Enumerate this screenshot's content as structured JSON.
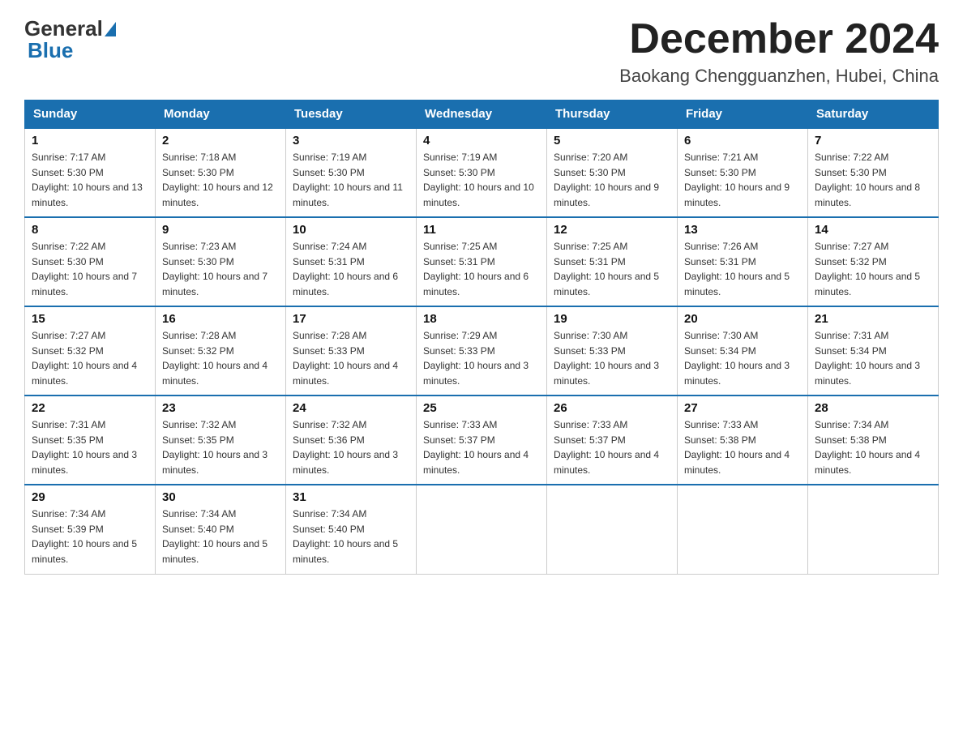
{
  "header": {
    "logo": {
      "text1": "General",
      "text2": "Blue"
    },
    "title": "December 2024",
    "location": "Baokang Chengguanzhen, Hubei, China"
  },
  "weekdays": [
    "Sunday",
    "Monday",
    "Tuesday",
    "Wednesday",
    "Thursday",
    "Friday",
    "Saturday"
  ],
  "weeks": [
    [
      {
        "day": "1",
        "sunrise": "7:17 AM",
        "sunset": "5:30 PM",
        "daylight": "10 hours and 13 minutes."
      },
      {
        "day": "2",
        "sunrise": "7:18 AM",
        "sunset": "5:30 PM",
        "daylight": "10 hours and 12 minutes."
      },
      {
        "day": "3",
        "sunrise": "7:19 AM",
        "sunset": "5:30 PM",
        "daylight": "10 hours and 11 minutes."
      },
      {
        "day": "4",
        "sunrise": "7:19 AM",
        "sunset": "5:30 PM",
        "daylight": "10 hours and 10 minutes."
      },
      {
        "day": "5",
        "sunrise": "7:20 AM",
        "sunset": "5:30 PM",
        "daylight": "10 hours and 9 minutes."
      },
      {
        "day": "6",
        "sunrise": "7:21 AM",
        "sunset": "5:30 PM",
        "daylight": "10 hours and 9 minutes."
      },
      {
        "day": "7",
        "sunrise": "7:22 AM",
        "sunset": "5:30 PM",
        "daylight": "10 hours and 8 minutes."
      }
    ],
    [
      {
        "day": "8",
        "sunrise": "7:22 AM",
        "sunset": "5:30 PM",
        "daylight": "10 hours and 7 minutes."
      },
      {
        "day": "9",
        "sunrise": "7:23 AM",
        "sunset": "5:30 PM",
        "daylight": "10 hours and 7 minutes."
      },
      {
        "day": "10",
        "sunrise": "7:24 AM",
        "sunset": "5:31 PM",
        "daylight": "10 hours and 6 minutes."
      },
      {
        "day": "11",
        "sunrise": "7:25 AM",
        "sunset": "5:31 PM",
        "daylight": "10 hours and 6 minutes."
      },
      {
        "day": "12",
        "sunrise": "7:25 AM",
        "sunset": "5:31 PM",
        "daylight": "10 hours and 5 minutes."
      },
      {
        "day": "13",
        "sunrise": "7:26 AM",
        "sunset": "5:31 PM",
        "daylight": "10 hours and 5 minutes."
      },
      {
        "day": "14",
        "sunrise": "7:27 AM",
        "sunset": "5:32 PM",
        "daylight": "10 hours and 5 minutes."
      }
    ],
    [
      {
        "day": "15",
        "sunrise": "7:27 AM",
        "sunset": "5:32 PM",
        "daylight": "10 hours and 4 minutes."
      },
      {
        "day": "16",
        "sunrise": "7:28 AM",
        "sunset": "5:32 PM",
        "daylight": "10 hours and 4 minutes."
      },
      {
        "day": "17",
        "sunrise": "7:28 AM",
        "sunset": "5:33 PM",
        "daylight": "10 hours and 4 minutes."
      },
      {
        "day": "18",
        "sunrise": "7:29 AM",
        "sunset": "5:33 PM",
        "daylight": "10 hours and 3 minutes."
      },
      {
        "day": "19",
        "sunrise": "7:30 AM",
        "sunset": "5:33 PM",
        "daylight": "10 hours and 3 minutes."
      },
      {
        "day": "20",
        "sunrise": "7:30 AM",
        "sunset": "5:34 PM",
        "daylight": "10 hours and 3 minutes."
      },
      {
        "day": "21",
        "sunrise": "7:31 AM",
        "sunset": "5:34 PM",
        "daylight": "10 hours and 3 minutes."
      }
    ],
    [
      {
        "day": "22",
        "sunrise": "7:31 AM",
        "sunset": "5:35 PM",
        "daylight": "10 hours and 3 minutes."
      },
      {
        "day": "23",
        "sunrise": "7:32 AM",
        "sunset": "5:35 PM",
        "daylight": "10 hours and 3 minutes."
      },
      {
        "day": "24",
        "sunrise": "7:32 AM",
        "sunset": "5:36 PM",
        "daylight": "10 hours and 3 minutes."
      },
      {
        "day": "25",
        "sunrise": "7:33 AM",
        "sunset": "5:37 PM",
        "daylight": "10 hours and 4 minutes."
      },
      {
        "day": "26",
        "sunrise": "7:33 AM",
        "sunset": "5:37 PM",
        "daylight": "10 hours and 4 minutes."
      },
      {
        "day": "27",
        "sunrise": "7:33 AM",
        "sunset": "5:38 PM",
        "daylight": "10 hours and 4 minutes."
      },
      {
        "day": "28",
        "sunrise": "7:34 AM",
        "sunset": "5:38 PM",
        "daylight": "10 hours and 4 minutes."
      }
    ],
    [
      {
        "day": "29",
        "sunrise": "7:34 AM",
        "sunset": "5:39 PM",
        "daylight": "10 hours and 5 minutes."
      },
      {
        "day": "30",
        "sunrise": "7:34 AM",
        "sunset": "5:40 PM",
        "daylight": "10 hours and 5 minutes."
      },
      {
        "day": "31",
        "sunrise": "7:34 AM",
        "sunset": "5:40 PM",
        "daylight": "10 hours and 5 minutes."
      },
      null,
      null,
      null,
      null
    ]
  ]
}
